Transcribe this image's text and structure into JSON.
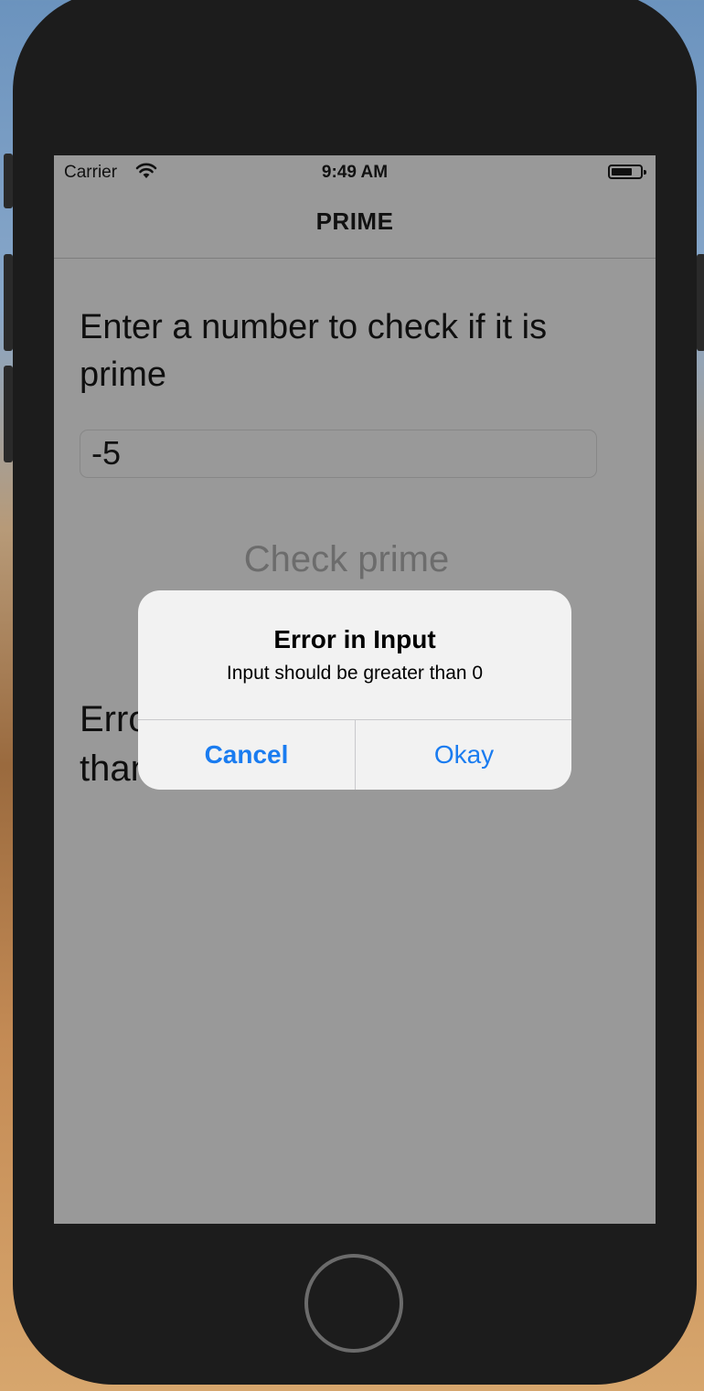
{
  "status_bar": {
    "carrier": "Carrier",
    "time": "9:49 AM",
    "icons": [
      "wifi-icon",
      "battery-icon"
    ]
  },
  "nav": {
    "title": "PRIME"
  },
  "main": {
    "prompt": "Enter a number to check if it is prime",
    "input_value": "-5",
    "check_button_label": "Check prime",
    "result_text": "Error: Input should be greater than 0"
  },
  "alert": {
    "title": "Error in Input",
    "message": "Input should be greater than 0",
    "cancel_label": "Cancel",
    "okay_label": "Okay"
  },
  "colors": {
    "dimmed_background": "#999999",
    "alert_background": "#f2f2f2",
    "ios_blue": "#1a7cf0",
    "device_body": "#1c1c1c"
  }
}
